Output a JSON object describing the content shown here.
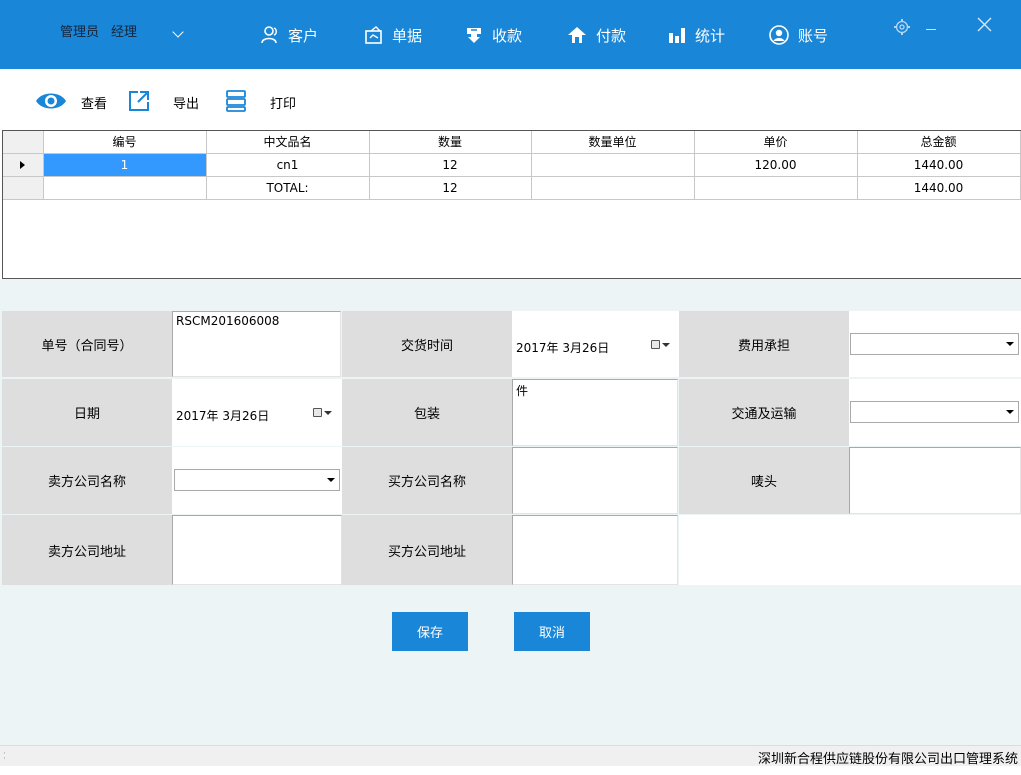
{
  "header": {
    "user_role": "管理员",
    "user_title": "经理",
    "nav": [
      {
        "label": "客户",
        "icon": "customer-icon"
      },
      {
        "label": "单据",
        "icon": "document-icon"
      },
      {
        "label": "收款",
        "icon": "receive-icon"
      },
      {
        "label": "付款",
        "icon": "payment-icon"
      },
      {
        "label": "统计",
        "icon": "chart-icon"
      },
      {
        "label": "账号",
        "icon": "account-icon"
      }
    ]
  },
  "toolbar": {
    "view_label": "查看",
    "export_label": "导出",
    "print_label": "打印"
  },
  "grid": {
    "columns": [
      "编号",
      "中文品名",
      "数量",
      "数量单位",
      "单价",
      "总金额"
    ],
    "rows": [
      {
        "no": "1",
        "name": "cn1",
        "qty": "12",
        "unit": "",
        "price": "120.00",
        "total": "1440.00"
      },
      {
        "no": "",
        "name": "TOTAL:",
        "qty": "12",
        "unit": "",
        "price": "",
        "total": "1440.00"
      }
    ]
  },
  "form": {
    "order_no_label": "单号（合同号）",
    "order_no_value": "RSCM201606008",
    "delivery_time_label": "交货时间",
    "delivery_time_value": "2017年  3月26日",
    "cost_label": "费用承担",
    "cost_value": "",
    "date_label": "日期",
    "date_value": "2017年  3月26日",
    "packing_label": "包装",
    "packing_value": "件",
    "transport_label": "交通及运输",
    "transport_value": "",
    "seller_name_label": "卖方公司名称",
    "seller_name_value": "",
    "buyer_name_label": "买方公司名称",
    "buyer_name_value": "",
    "mark_label": "唛头",
    "mark_value": "",
    "seller_addr_label": "卖方公司地址",
    "seller_addr_value": "",
    "buyer_addr_label": "买方公司地址",
    "buyer_addr_value": ""
  },
  "actions": {
    "save_label": "保存",
    "cancel_label": "取消"
  },
  "status": {
    "text": "深圳新合程供应链股份有限公司出口管理系统"
  },
  "colors": {
    "accent": "#1a86d8",
    "selection": "#3399ff",
    "label_bg": "#dedede",
    "panel_bg": "#edf4f6"
  }
}
